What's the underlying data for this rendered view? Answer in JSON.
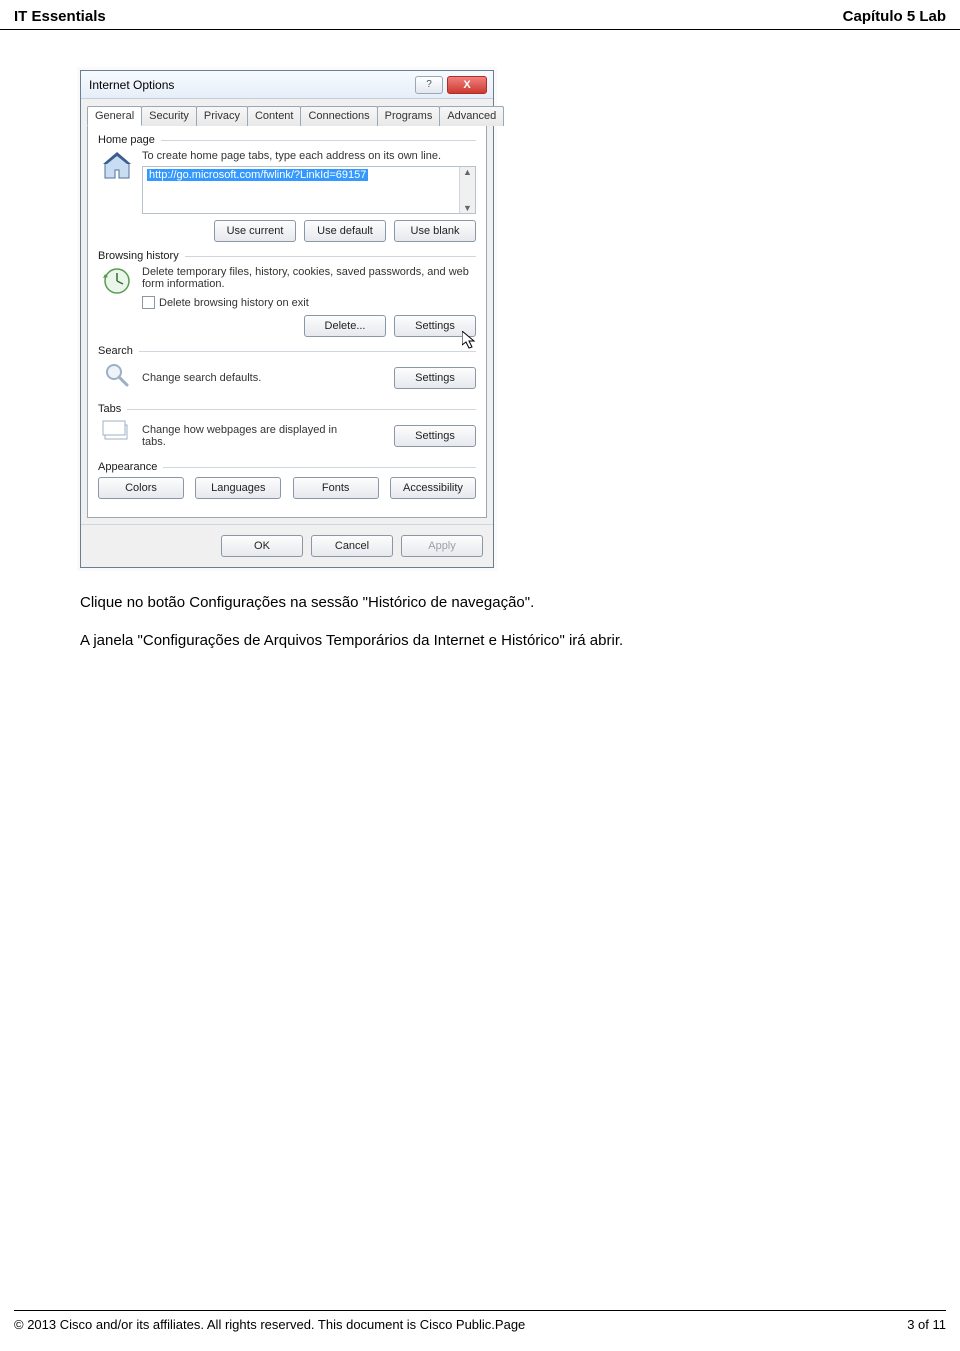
{
  "header": {
    "left": "IT Essentials",
    "right": "Capítulo 5 Lab"
  },
  "dialog": {
    "title": "Internet Options",
    "help_btn": "?",
    "close_btn": "X",
    "tabs": [
      "General",
      "Security",
      "Privacy",
      "Content",
      "Connections",
      "Programs",
      "Advanced"
    ],
    "active_tab": 0,
    "home": {
      "label": "Home page",
      "text": "To create home page tabs, type each address on its own line.",
      "url": "http://go.microsoft.com/fwlink/?LinkId=69157",
      "btn_current": "Use current",
      "btn_default": "Use default",
      "btn_blank": "Use blank"
    },
    "history": {
      "label": "Browsing history",
      "text": "Delete temporary files, history, cookies, saved passwords, and web form information.",
      "checkbox": "Delete browsing history on exit",
      "btn_delete": "Delete...",
      "btn_settings": "Settings"
    },
    "search": {
      "label": "Search",
      "text": "Change search defaults.",
      "btn_settings": "Settings"
    },
    "tabs_group": {
      "label": "Tabs",
      "text": "Change how webpages are displayed in tabs.",
      "btn_settings": "Settings"
    },
    "appearance": {
      "label": "Appearance",
      "btn_colors": "Colors",
      "btn_languages": "Languages",
      "btn_fonts": "Fonts",
      "btn_accessibility": "Accessibility"
    },
    "bottom": {
      "ok": "OK",
      "cancel": "Cancel",
      "apply": "Apply"
    }
  },
  "instructions": {
    "line1": "Clique no botão Configurações na sessão \"Histórico de navegação\".",
    "line2": "A janela \"Configurações de Arquivos Temporários da Internet e Histórico\" irá abrir."
  },
  "footer": {
    "left": "© 2013 Cisco and/or its affiliates. All rights reserved. This document is Cisco Public.Page",
    "right": "3 of 11"
  }
}
